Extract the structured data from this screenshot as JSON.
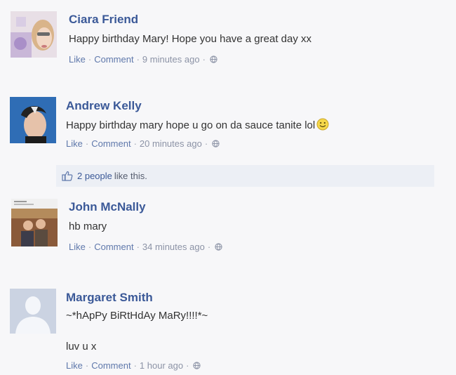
{
  "comments": [
    {
      "name": "Ciara Friend",
      "message": "Happy birthday Mary! Hope you have a great day xx",
      "like": "Like",
      "comment": "Comment",
      "time": "9 minutes ago"
    },
    {
      "name": "Andrew Kelly",
      "message": "Happy birthday mary hope u go on da sauce tanite lol",
      "like": "Like",
      "comment": "Comment",
      "time": "20 minutes ago"
    },
    {
      "name": "John McNally",
      "message": "hb mary",
      "like": "Like",
      "comment": "Comment",
      "time": "34 minutes ago"
    },
    {
      "name": "Margaret Smith",
      "message": "~*hApPy BiRtHdAy MaRy!!!!*~",
      "message2": "luv u x",
      "like": "Like",
      "comment": "Comment",
      "time": "1 hour ago"
    }
  ],
  "likes": {
    "count_text": "2 people",
    "tail_text": "like this."
  },
  "separator": "·",
  "icons": {
    "globe": "globe-icon",
    "smiley": "smiley-emoticon-icon",
    "thumb": "thumbs-up-icon"
  },
  "colors": {
    "name": "#3b5998",
    "link": "#5f78ab",
    "meta": "#8c93a6",
    "likes_bg": "#eceff5"
  }
}
